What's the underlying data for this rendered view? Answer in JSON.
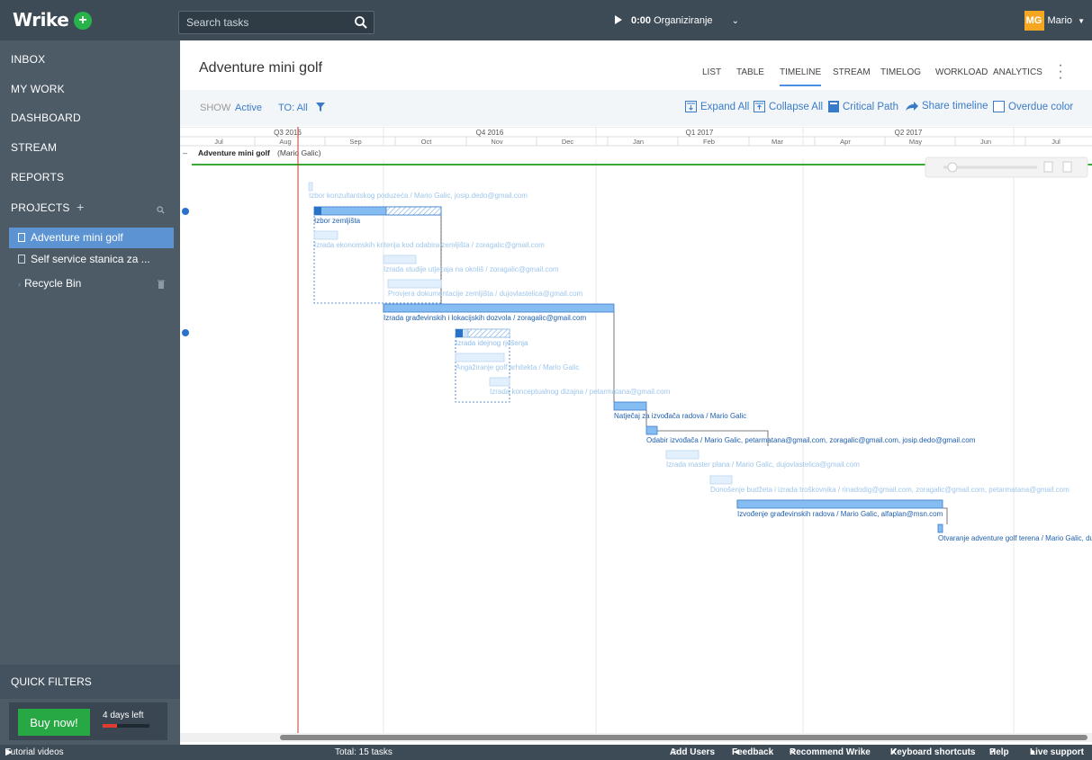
{
  "topbar": {
    "logo": "Wrike",
    "plus": "+",
    "search_placeholder": "Search tasks",
    "timer_time": "0:00",
    "timer_task": "Organiziranje",
    "avatar_initials": "MG",
    "user_name": "Mario"
  },
  "sidebar": {
    "items": [
      "INBOX",
      "MY WORK",
      "DASHBOARD",
      "STREAM",
      "REPORTS"
    ],
    "projects_label": "PROJECTS",
    "projects_plus": "+",
    "projects": [
      "Adventure mini golf",
      "Self service stanica za ..."
    ],
    "recycle_bin": "Recycle Bin",
    "quick_filters": "QUICK FILTERS",
    "buy_now": "Buy now!",
    "days_left": "4 days left",
    "trial_progress": 0.3
  },
  "header": {
    "title": "Adventure mini golf",
    "tabs": [
      "LIST",
      "TABLE",
      "TIMELINE",
      "STREAM",
      "TIMELOG",
      "WORKLOAD",
      "ANALYTICS"
    ],
    "active_tab": "TIMELINE"
  },
  "toolbar": {
    "show_label": "SHOW",
    "show_value": "Active",
    "to_value": "TO: All",
    "expand_all": "Expand All",
    "collapse_all": "Collapse All",
    "critical_path": "Critical Path",
    "share_timeline": "Share timeline",
    "overdue_color": "Overdue color"
  },
  "timeline": {
    "quarters": [
      "Q3 2016",
      "Q4 2016",
      "Q1 2017",
      "Q2 2017"
    ],
    "months": [
      "Jul",
      "Aug",
      "Sep",
      "Oct",
      "Nov",
      "Dec",
      "Jan",
      "Feb",
      "Mar",
      "Apr",
      "May",
      "Jun",
      "Jul"
    ],
    "project_row_name": "Adventure mini golf",
    "project_row_owner": "(Mario Galic)",
    "tasks": [
      {
        "label": "Izbor konzultantskog poduzeća / Mario Galic, josip.dedo@gmail.com",
        "style": "faded"
      },
      {
        "label": "Izbor zemljišta",
        "style": "group"
      },
      {
        "label": "Izrada ekonomskih kriterija kod odabira zemljišta / zoragalic@gmail.com",
        "style": "faded"
      },
      {
        "label": "Izrada studije utjecaja na okoliš / zoragalic@gmail.com",
        "style": "faded"
      },
      {
        "label": "Provjera dokumentacije zemljišta / dujovlastelica@gmail.com",
        "style": "faded"
      },
      {
        "label": "Izrada građevinskih i lokacijskih dozvola / zoragalic@gmail.com",
        "style": "critical"
      },
      {
        "label": "Izrada idejnog rješenja",
        "style": "group-faded"
      },
      {
        "label": "Angažiranje golf arhitekta / Mario Galic",
        "style": "faded"
      },
      {
        "label": "Izrada konceptualnog dizajna / petarmatana@gmail.com",
        "style": "faded"
      },
      {
        "label": "Natječaj za izvođača radova / Mario Galic",
        "style": "critical"
      },
      {
        "label": "Odabir izvođača / Mario Galic, petarmatana@gmail.com, zoragalic@gmail.com, josip.dedo@gmail.com",
        "style": "critical"
      },
      {
        "label": "Izrada master plana / Mario Galic, dujovlastelica@gmail.com",
        "style": "faded"
      },
      {
        "label": "Donošenje budžeta i izrada troškovnika / rinadodig@gmail.com, zoragalic@gmail.com, petarmatana@gmail.com",
        "style": "faded"
      },
      {
        "label": "Izvođenje građevinskih radova / Mario Galic, alfaplan@msn.com",
        "style": "critical"
      },
      {
        "label": "Otvaranje adventure golf terena / Mario Galic, du",
        "style": "critical"
      }
    ]
  },
  "footer": {
    "tutorial": "Tutorial videos",
    "total": "Total: 15 tasks",
    "add_users": "Add Users",
    "feedback": "Feedback",
    "recommend": "Recommend Wrike",
    "shortcuts": "Keyboard shortcuts",
    "help": "Help",
    "live_support": "Live support"
  },
  "colors": {
    "topbar_bg": "#3d4b57",
    "sidebar_bg": "#4d5b67",
    "accent": "#4a90e2",
    "critical_bar": "#85bdf2",
    "faded_bar": "#e2f0fd",
    "today_line": "#c0392b",
    "project_line": "#3aaa35",
    "buy_button": "#28a745"
  }
}
